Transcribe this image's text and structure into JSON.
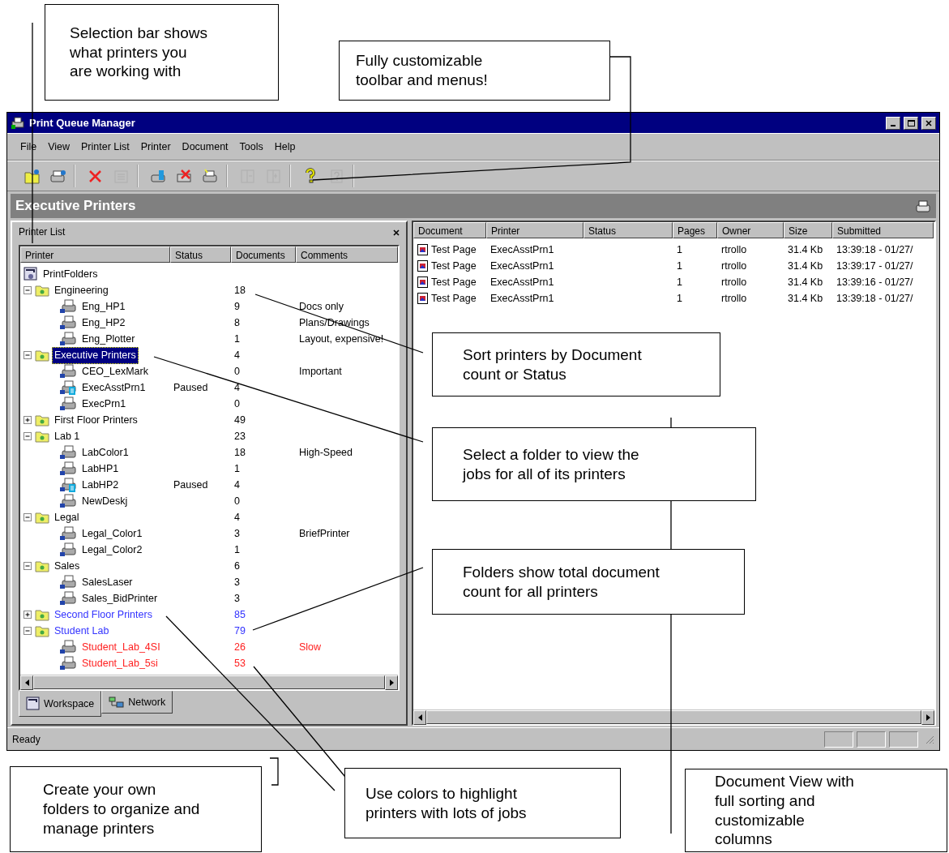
{
  "window": {
    "title": "Print Queue Manager"
  },
  "menu": [
    "File",
    "View",
    "Printer List",
    "Printer",
    "Document",
    "Tools",
    "Help"
  ],
  "toolbar": [
    [
      {
        "kind": "open-folder",
        "disabled": false
      },
      {
        "kind": "printer-connect",
        "disabled": false
      }
    ],
    [
      {
        "kind": "delete",
        "disabled": false
      },
      {
        "kind": "properties",
        "disabled": true
      }
    ],
    [
      {
        "kind": "printer-queue",
        "disabled": false
      },
      {
        "kind": "purge-jobs",
        "disabled": false
      },
      {
        "kind": "printer-refresh",
        "disabled": false
      }
    ],
    [
      {
        "kind": "tile-left",
        "disabled": true
      },
      {
        "kind": "tile-right",
        "disabled": true
      }
    ],
    [
      {
        "kind": "help",
        "disabled": false
      },
      {
        "kind": "context-help",
        "disabled": true
      }
    ]
  ],
  "selection_bar": {
    "title": "Executive Printers"
  },
  "printer_list": {
    "title": "Printer List",
    "columns": [
      "Printer",
      "Status",
      "Documents",
      "Comments"
    ],
    "tree": [
      {
        "kind": "root",
        "name": "PrintFolders",
        "selected": false,
        "color": "#000000",
        "children": [
          {
            "kind": "folder",
            "name": "Engineering",
            "documents": "18",
            "expanded": true,
            "selected": false,
            "color": "#000000",
            "children": [
              {
                "kind": "printer",
                "name": "Eng_HP1",
                "documents": "9",
                "comments": "Docs only",
                "paused": false,
                "selected": false,
                "color": "#000000"
              },
              {
                "kind": "printer",
                "name": "Eng_HP2",
                "documents": "8",
                "comments": "Plans/Drawings",
                "paused": false,
                "selected": false,
                "color": "#000000"
              },
              {
                "kind": "printer",
                "name": "Eng_Plotter",
                "documents": "1",
                "comments": "Layout, expensive!",
                "paused": false,
                "selected": false,
                "color": "#000000"
              }
            ]
          },
          {
            "kind": "folder",
            "name": "Executive Printers",
            "documents": "4",
            "expanded": true,
            "selected": true,
            "color": "#000000",
            "children": [
              {
                "kind": "printer",
                "name": "CEO_LexMark",
                "documents": "0",
                "comments": "Important",
                "paused": false,
                "selected": false,
                "color": "#000000"
              },
              {
                "kind": "printer",
                "name": "ExecAsstPrn1",
                "status": "Paused",
                "documents": "4",
                "paused": true,
                "selected": false,
                "color": "#000000"
              },
              {
                "kind": "printer",
                "name": "ExecPrn1",
                "documents": "0",
                "paused": false,
                "selected": false,
                "color": "#000000"
              }
            ]
          },
          {
            "kind": "folder",
            "name": "First Floor Printers",
            "documents": "49",
            "expanded": false,
            "selected": false,
            "color": "#000000"
          },
          {
            "kind": "folder",
            "name": "Lab 1",
            "documents": "23",
            "expanded": true,
            "selected": false,
            "color": "#000000",
            "children": [
              {
                "kind": "printer",
                "name": "LabColor1",
                "documents": "18",
                "comments": "High-Speed",
                "paused": false,
                "selected": false,
                "color": "#000000"
              },
              {
                "kind": "printer",
                "name": "LabHP1",
                "documents": "1",
                "paused": false,
                "selected": false,
                "color": "#000000"
              },
              {
                "kind": "printer",
                "name": "LabHP2",
                "status": "Paused",
                "documents": "4",
                "paused": true,
                "selected": false,
                "color": "#000000"
              },
              {
                "kind": "printer",
                "name": "NewDeskj",
                "documents": "0",
                "paused": false,
                "selected": false,
                "color": "#000000"
              }
            ]
          },
          {
            "kind": "folder",
            "name": "Legal",
            "documents": "4",
            "expanded": true,
            "selected": false,
            "color": "#000000",
            "children": [
              {
                "kind": "printer",
                "name": "Legal_Color1",
                "documents": "3",
                "comments": "BriefPrinter",
                "paused": false,
                "selected": false,
                "color": "#000000"
              },
              {
                "kind": "printer",
                "name": "Legal_Color2",
                "documents": "1",
                "paused": false,
                "selected": false,
                "color": "#000000"
              }
            ]
          },
          {
            "kind": "folder",
            "name": "Sales",
            "documents": "6",
            "expanded": true,
            "selected": false,
            "color": "#000000",
            "children": [
              {
                "kind": "printer",
                "name": "SalesLaser",
                "documents": "3",
                "paused": false,
                "selected": false,
                "color": "#000000"
              },
              {
                "kind": "printer",
                "name": "Sales_BidPrinter",
                "documents": "3",
                "paused": false,
                "selected": false,
                "color": "#000000"
              }
            ]
          },
          {
            "kind": "folder",
            "name": "Second Floor Printers",
            "documents": "85",
            "expanded": false,
            "selected": false,
            "color": "#3333ff"
          },
          {
            "kind": "folder",
            "name": "Student Lab",
            "documents": "79",
            "expanded": true,
            "selected": false,
            "color": "#3333ff",
            "children": [
              {
                "kind": "printer",
                "name": "Student_Lab_4SI",
                "documents": "26",
                "comments": "Slow",
                "paused": false,
                "selected": false,
                "color": "#ff2020"
              },
              {
                "kind": "printer",
                "name": "Student_Lab_5si",
                "documents": "53",
                "paused": false,
                "selected": false,
                "color": "#ff2020"
              }
            ]
          }
        ]
      }
    ]
  },
  "tabs": [
    {
      "label": "Workspace",
      "selected": true
    },
    {
      "label": "Network",
      "selected": false
    }
  ],
  "documents": {
    "columns": [
      "Document",
      "Printer",
      "Status",
      "Pages",
      "Owner",
      "Size",
      "Submitted"
    ],
    "rows": [
      {
        "document": "Test Page",
        "printer": "ExecAsstPrn1",
        "pages": "1",
        "owner": "rtrollo",
        "size": "31.4 Kb",
        "submitted": "13:39:18 - 01/27/"
      },
      {
        "document": "Test Page",
        "printer": "ExecAsstPrn1",
        "pages": "1",
        "owner": "rtrollo",
        "size": "31.4 Kb",
        "submitted": "13:39:17 - 01/27/"
      },
      {
        "document": "Test Page",
        "printer": "ExecAsstPrn1",
        "pages": "1",
        "owner": "rtrollo",
        "size": "31.4 Kb",
        "submitted": "13:39:16 - 01/27/"
      },
      {
        "document": "Test Page",
        "printer": "ExecAsstPrn1",
        "pages": "1",
        "owner": "rtrollo",
        "size": "31.4 Kb",
        "submitted": "13:39:18 - 01/27/"
      }
    ]
  },
  "status_bar": {
    "text": "Ready"
  },
  "callouts": [
    {
      "text": "Selection bar shows what printers you are working with"
    },
    {
      "text": "Fully customizable toolbar and menus!"
    },
    {
      "text": "Sort printers by Document count or Status"
    },
    {
      "text": "Select a folder to view the jobs for all of its printers"
    },
    {
      "text": "Folders show total document count for all printers"
    },
    {
      "text": "Create your own folders to organize and manage printers"
    },
    {
      "text": "Use colors to highlight printers with lots of jobs"
    },
    {
      "text": "Document View with full sorting and customizable columns"
    }
  ]
}
